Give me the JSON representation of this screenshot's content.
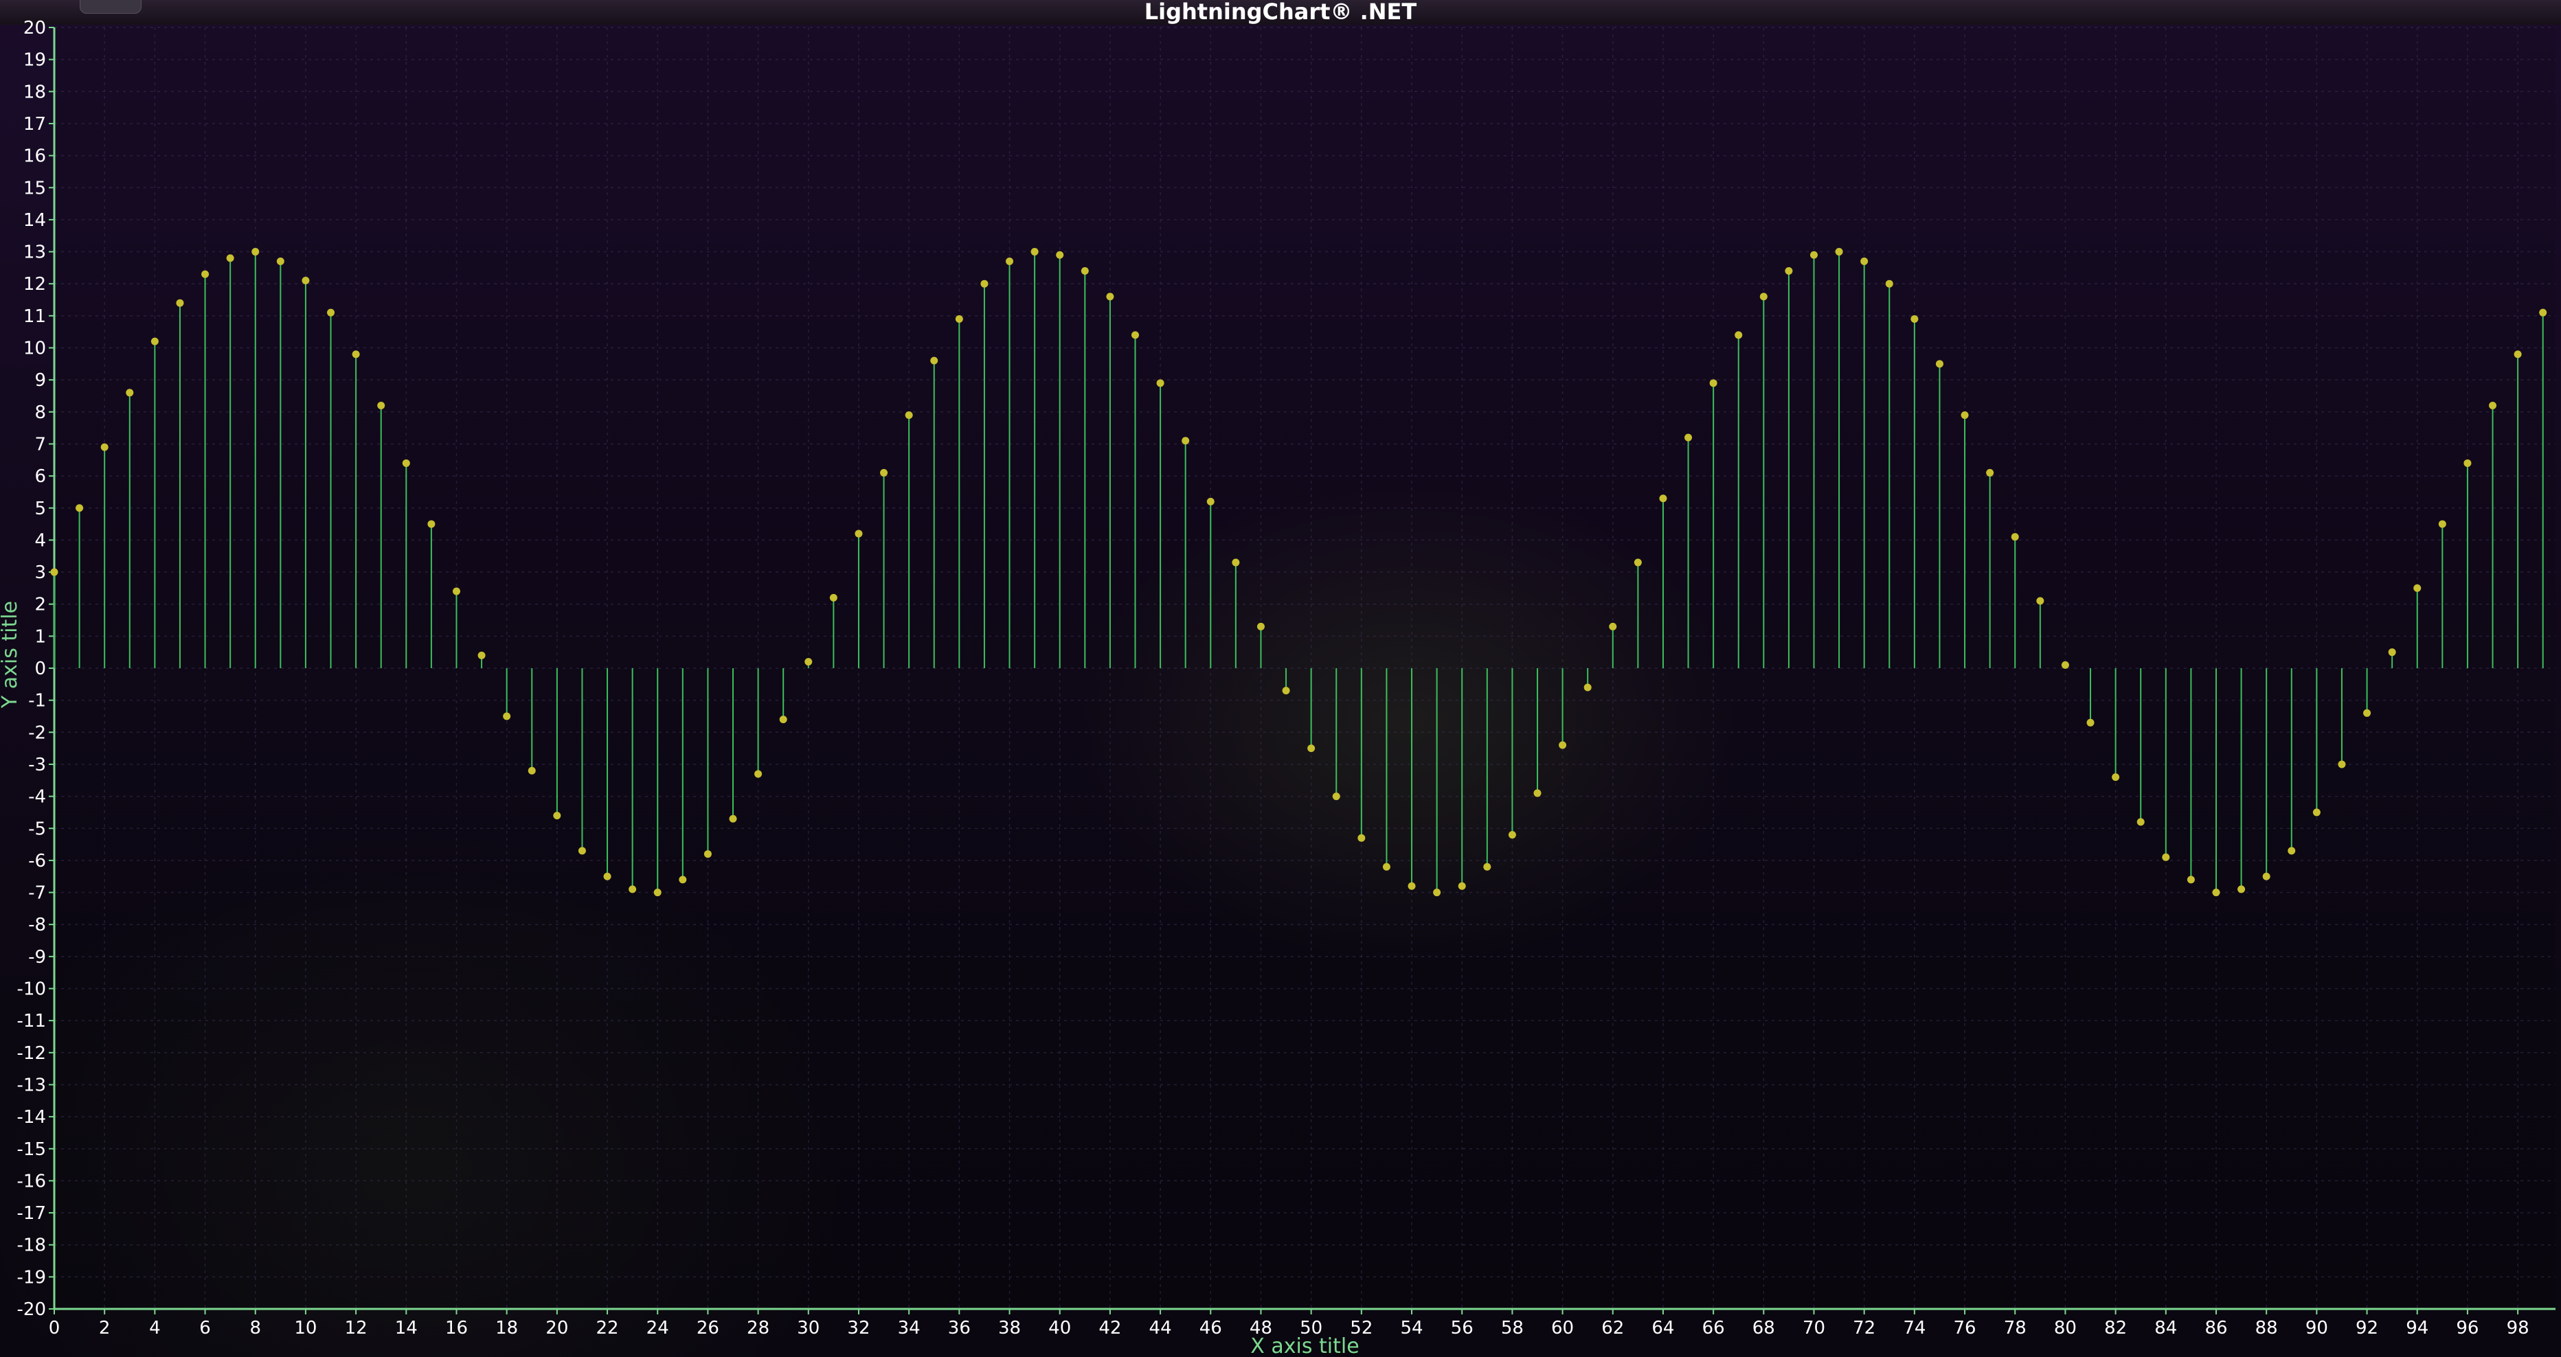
{
  "window": {
    "title": "LightningChart® .NET"
  },
  "icons": {
    "collapse": "chevron-up-icon"
  },
  "colors": {
    "stem": "#3cbf5a",
    "point": "#c8c030",
    "axis": "#7cd88f",
    "grid": "#3a3050",
    "tick_label": "#ffffff"
  },
  "chart_data": {
    "type": "stem",
    "title": "LightningChart® .NET",
    "xlabel": "X axis title",
    "ylabel": "Y axis title",
    "xlim": [
      0,
      99.5
    ],
    "ylim": [
      -20,
      20
    ],
    "x_ticks": [
      0,
      2,
      4,
      6,
      8,
      10,
      12,
      14,
      16,
      18,
      20,
      22,
      24,
      26,
      28,
      30,
      32,
      34,
      36,
      38,
      40,
      42,
      44,
      46,
      48,
      50,
      52,
      54,
      56,
      58,
      60,
      62,
      64,
      66,
      68,
      70,
      72,
      74,
      76,
      78,
      80,
      82,
      84,
      86,
      88,
      90,
      92,
      94,
      96,
      98
    ],
    "y_ticks": [
      20,
      19,
      18,
      17,
      16,
      15,
      14,
      13,
      12,
      11,
      10,
      9,
      8,
      7,
      6,
      5,
      4,
      3,
      2,
      1,
      0,
      -1,
      -2,
      -3,
      -4,
      -5,
      -6,
      -7,
      -8,
      -9,
      -10,
      -11,
      -12,
      -13,
      -14,
      -15,
      -16,
      -17,
      -18,
      -19,
      -20
    ],
    "grid": true,
    "baseline": 0,
    "series": [
      {
        "x": [
          0,
          1,
          2,
          3,
          4,
          5,
          6,
          7,
          8,
          9,
          10,
          11,
          12,
          13,
          14,
          15,
          16,
          17,
          18,
          19,
          20,
          21,
          22,
          23,
          24,
          25,
          26,
          27,
          28,
          29,
          30,
          31,
          32,
          33,
          34,
          35,
          36,
          37,
          38,
          39,
          40,
          41,
          42,
          43,
          44,
          45,
          46,
          47,
          48,
          49,
          50,
          51,
          52,
          53,
          54,
          55,
          56,
          57,
          58,
          59,
          60,
          61,
          62,
          63,
          64,
          65,
          66,
          67,
          68,
          69,
          70,
          71,
          72,
          73,
          74,
          75,
          76,
          77,
          78,
          79,
          80,
          81,
          82,
          83,
          84,
          85,
          86,
          87,
          88,
          89,
          90,
          91,
          92,
          93,
          94,
          95,
          96,
          97,
          98,
          99
        ],
        "values": [
          3.0,
          5.0,
          6.9,
          8.6,
          10.2,
          11.4,
          12.3,
          12.8,
          13.0,
          12.7,
          12.1,
          11.1,
          9.8,
          8.2,
          6.4,
          4.5,
          2.4,
          0.4,
          -1.5,
          -3.2,
          -4.6,
          -5.7,
          -6.5,
          -6.9,
          -7.0,
          -6.6,
          -5.8,
          -4.7,
          -3.3,
          -1.6,
          0.2,
          2.2,
          4.2,
          6.1,
          7.9,
          9.6,
          10.9,
          12.0,
          12.7,
          13.0,
          12.9,
          12.4,
          11.6,
          10.4,
          8.9,
          7.1,
          5.2,
          3.3,
          1.3,
          -0.7,
          -2.5,
          -4.0,
          -5.3,
          -6.2,
          -6.8,
          -7.0,
          -6.8,
          -6.2,
          -5.2,
          -3.9,
          -2.4,
          -0.6,
          1.3,
          3.3,
          5.3,
          7.2,
          8.9,
          10.4,
          11.6,
          12.4,
          12.9,
          13.0,
          12.7,
          12.0,
          10.9,
          9.5,
          7.9,
          6.1,
          4.1,
          2.1,
          0.1,
          -1.7,
          -3.4,
          -4.8,
          -5.9,
          -6.6,
          -7.0,
          -6.9,
          -6.5,
          -5.7,
          -4.5,
          -3.0,
          -1.4,
          0.5,
          2.5,
          4.5,
          6.4,
          8.2,
          9.8,
          11.1
        ]
      }
    ]
  },
  "labels": {
    "x_axis_title": "X axis title",
    "y_axis_title": "Y axis title"
  }
}
